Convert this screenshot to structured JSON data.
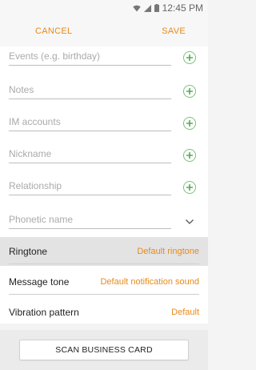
{
  "status_bar": {
    "time": "12:45 PM"
  },
  "action_bar": {
    "cancel_label": "CANCEL",
    "save_label": "SAVE"
  },
  "fields": [
    {
      "placeholder": "Events (e.g. birthday)"
    },
    {
      "placeholder": "Notes"
    },
    {
      "placeholder": "IM accounts"
    },
    {
      "placeholder": "Nickname"
    },
    {
      "placeholder": "Relationship"
    },
    {
      "placeholder": "Phonetic name"
    }
  ],
  "settings": [
    {
      "label": "Ringtone",
      "value": "Default ringtone"
    },
    {
      "label": "Message tone",
      "value": "Default notification sound"
    },
    {
      "label": "Vibration pattern",
      "value": "Default"
    }
  ],
  "bottom": {
    "scan_label": "SCAN BUSINESS CARD"
  },
  "colors": {
    "accent": "#e88a1a",
    "plus": "#4caf50"
  }
}
